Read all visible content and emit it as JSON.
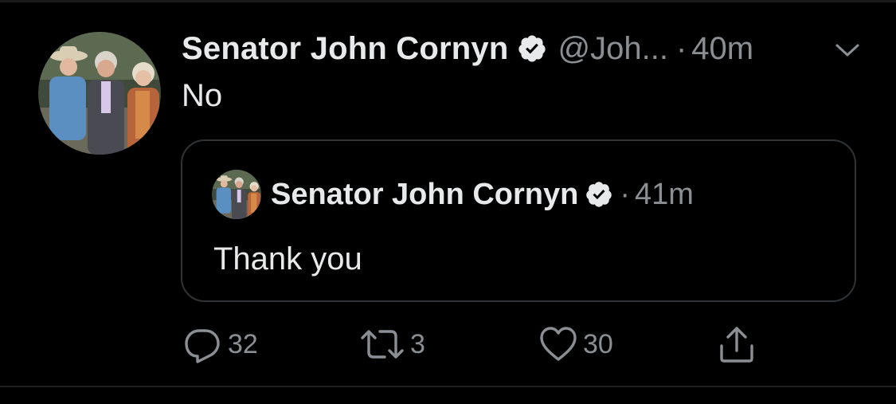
{
  "tweet": {
    "display_name": "Senator John Cornyn",
    "handle": "@Joh...",
    "separator": "·",
    "time": "40m",
    "verified_icon": "verified-badge-icon",
    "more_icon": "chevron-down-icon",
    "text": "No"
  },
  "quoted_tweet": {
    "display_name": "Senator John Cornyn",
    "separator": "·",
    "time": "41m",
    "verified_icon": "verified-badge-icon",
    "text": "Thank you"
  },
  "actions": {
    "reply": {
      "icon": "reply-icon",
      "count": "32"
    },
    "retweet": {
      "icon": "retweet-icon",
      "count": "3"
    },
    "like": {
      "icon": "heart-icon",
      "count": "30"
    },
    "share": {
      "icon": "share-icon"
    }
  },
  "colors": {
    "background": "#000000",
    "primary_text": "#e7e9ea",
    "secondary_text": "#8b8f93",
    "border": "#2f3336"
  }
}
